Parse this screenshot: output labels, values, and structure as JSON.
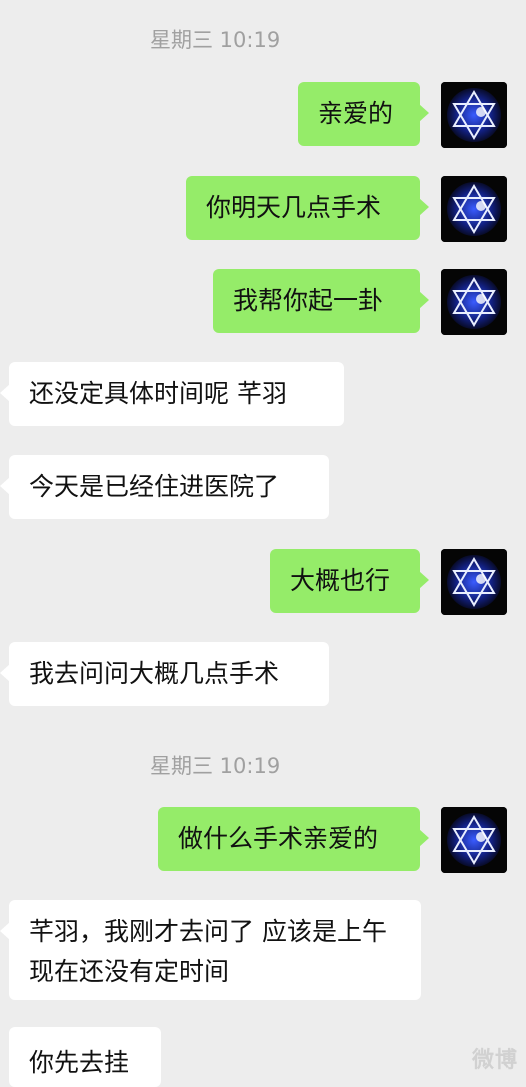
{
  "timestamps": [
    "星期三 10:19",
    "星期三 10:19"
  ],
  "messages": [
    {
      "side": "out",
      "text": "亲爱的"
    },
    {
      "side": "out",
      "text": "你明天几点手术"
    },
    {
      "side": "out",
      "text": "我帮你起一卦"
    },
    {
      "side": "in",
      "text": "还没定具体时间呢  芊羽"
    },
    {
      "side": "in",
      "text": "今天是已经住进医院了"
    },
    {
      "side": "out",
      "text": "大概也行"
    },
    {
      "side": "in",
      "text": "我去问问大概几点手术"
    },
    {
      "side": "out",
      "text": "做什么手术亲爱的"
    },
    {
      "side": "in",
      "text": "芊羽，我刚才去问了 应该是上午  现在还没有定时间"
    },
    {
      "side": "in",
      "text": "你先去挂"
    }
  ],
  "avatar_icon": "hexagram-avatar-icon",
  "colors": {
    "outgoing": "#95ec69",
    "incoming": "#ffffff",
    "background": "#ededed"
  },
  "watermark": "微博"
}
